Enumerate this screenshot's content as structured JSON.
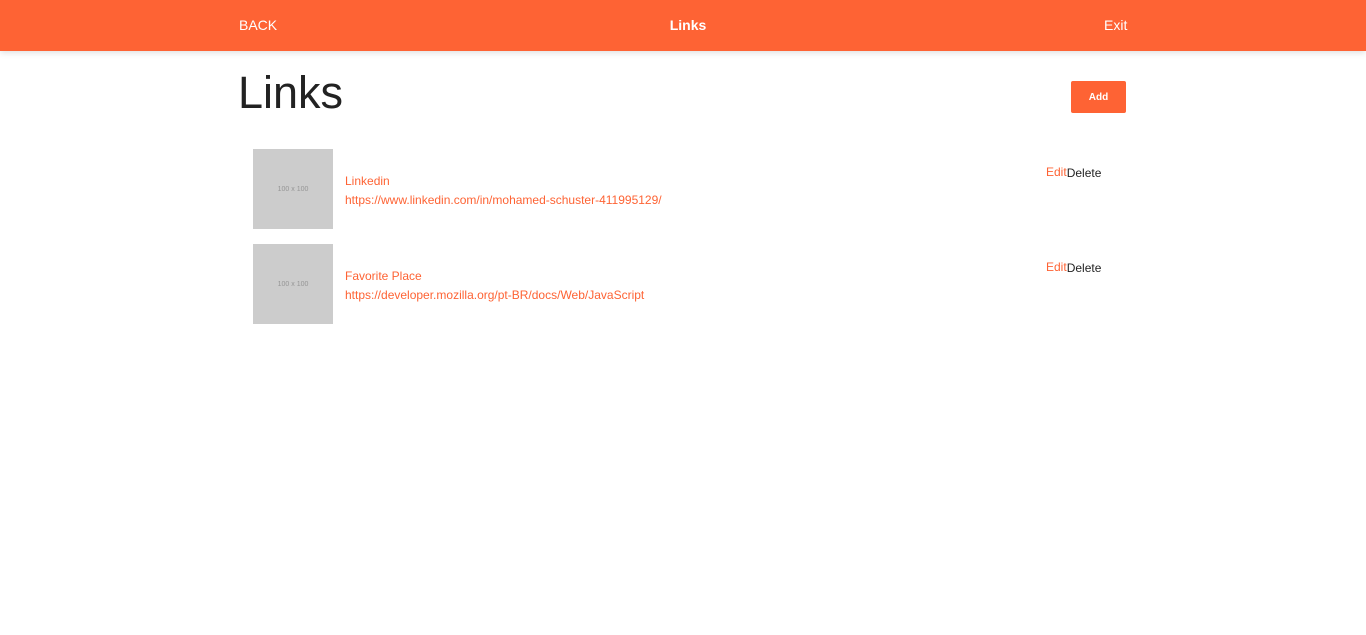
{
  "topbar": {
    "back_label": "BACK",
    "title": "Links",
    "exit_label": "Exit"
  },
  "page": {
    "title": "Links",
    "add_label": "Add"
  },
  "links": [
    {
      "thumbnail_text": "100 x 100",
      "name": "Linkedin",
      "url": "https://www.linkedin.com/in/mohamed-schuster-411995129/",
      "edit_label": "Edit",
      "delete_label": "Delete"
    },
    {
      "thumbnail_text": "100 x 100",
      "name": "Favorite Place",
      "url": "https://developer.mozilla.org/pt-BR/docs/Web/JavaScript",
      "edit_label": "Edit",
      "delete_label": "Delete"
    }
  ],
  "colors": {
    "accent": "#fe6334",
    "placeholder": "#cccccc",
    "text": "#222222"
  }
}
